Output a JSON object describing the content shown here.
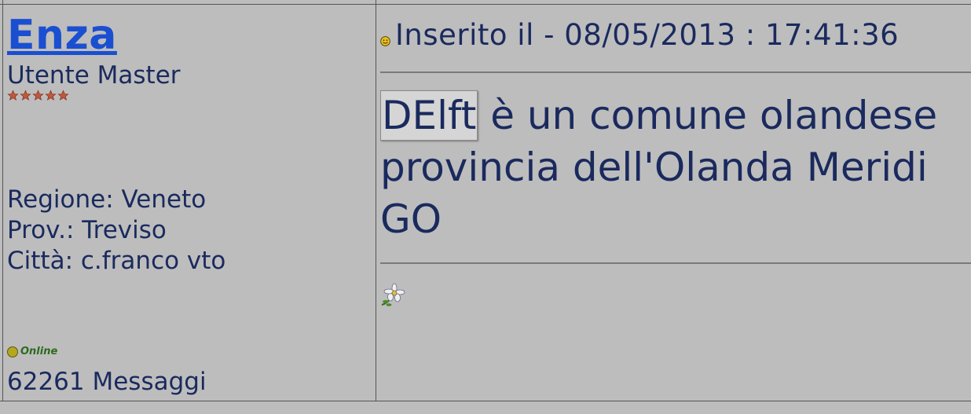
{
  "author": {
    "name": "Enza",
    "rank": "Utente Master",
    "star_count": 5,
    "region": "Regione: Veneto",
    "province": "Prov.: Treviso",
    "city": "Città: c.franco vto",
    "status": "Online",
    "message_count": "62261 Messaggi"
  },
  "post": {
    "icon": "smile-icon",
    "date": "Inserito il - 08/05/2013 : 17:41:36",
    "highlighted_word": "DElft",
    "line1_rest": " è un comune olandese",
    "line2": "provincia dell'Olanda Meridi",
    "line3": "GO",
    "signature_icon": "flower-icon"
  },
  "colors": {
    "background": "#bdbdbd",
    "text": "#1a2a5e",
    "author_link": "#1b4fd1",
    "star": "#c0583a",
    "online_text": "#2d6a1f"
  }
}
